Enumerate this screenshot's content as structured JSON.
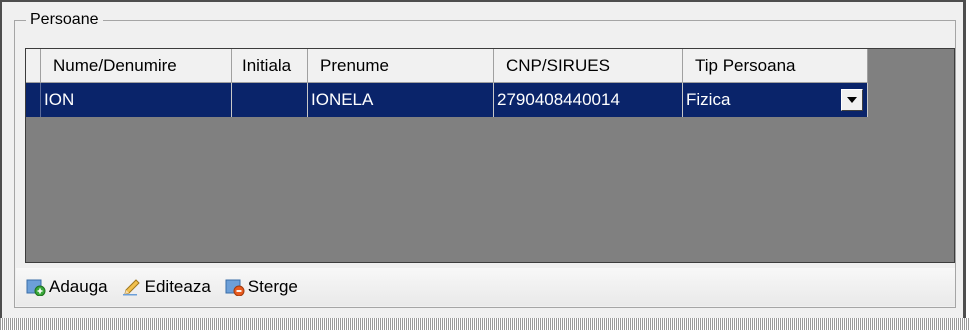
{
  "group": {
    "title": "Persoane"
  },
  "grid": {
    "columns": [
      {
        "label": "Nume/Denumire"
      },
      {
        "label": "Initiala"
      },
      {
        "label": "Prenume"
      },
      {
        "label": "CNP/SIRUES"
      },
      {
        "label": "Tip Persoana"
      }
    ],
    "rows": [
      {
        "nume": "ION",
        "initiala": "",
        "prenume": "IONELA",
        "cnp": "2790408440014",
        "tip": "Fizica"
      }
    ],
    "selection_color": "#0a246a",
    "empty_area_color": "#808080"
  },
  "toolbar": {
    "add_label": "Adauga",
    "edit_label": "Editeaza",
    "delete_label": "Sterge",
    "add_icon": "add-icon",
    "edit_icon": "pencil-icon",
    "delete_icon": "delete-icon"
  }
}
